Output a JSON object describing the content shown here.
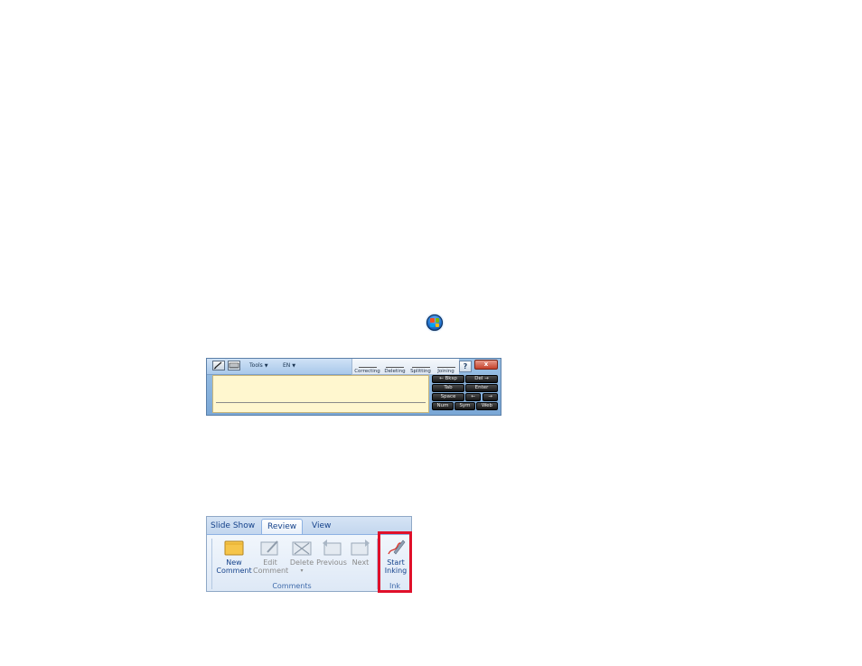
{
  "input_panel": {
    "tools_label": "Tools",
    "language_label": "EN",
    "gestures": [
      "Correcting",
      "Deleting",
      "Splitting",
      "Joining"
    ],
    "help_label": "?",
    "close_label": "x",
    "keys": [
      {
        "label": "←  Bksp"
      },
      {
        "label": "Del  →"
      },
      {
        "label": "Tab"
      },
      {
        "label": "Enter"
      },
      {
        "label": "Space"
      },
      {
        "label": "←"
      },
      {
        "label": "→"
      },
      {
        "label": "Num"
      },
      {
        "label": "Sym"
      },
      {
        "label": "Web"
      }
    ]
  },
  "ribbon": {
    "tabs": [
      "Slide Show",
      "Review",
      "View"
    ],
    "active_tab": "Review",
    "buttons": {
      "new_comment": [
        "New",
        "Comment"
      ],
      "edit_comment": [
        "Edit",
        "Comment"
      ],
      "delete": "Delete",
      "delete_caret": "▾",
      "previous": "Previous",
      "next": "Next",
      "start_inking": [
        "Start",
        "Inking"
      ]
    },
    "groups": {
      "comments": "Comments",
      "ink": "Ink"
    }
  },
  "colors": {
    "highlight": "#e0102a",
    "ribbon_text": "#15428b",
    "writing_area": "#fff7cf"
  }
}
